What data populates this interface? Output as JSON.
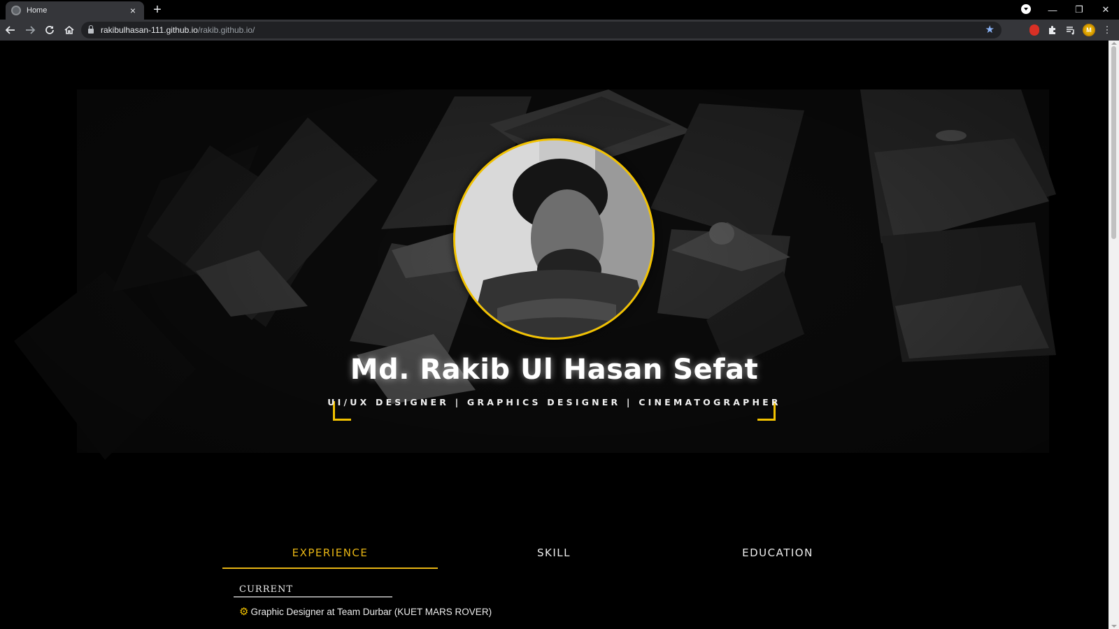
{
  "browser": {
    "tab_title": "Home",
    "tab_close": "×",
    "new_tab": "+",
    "url_host": "rakibulhasan-111.github.io",
    "url_path": "/rakib.github.io/"
  },
  "hero": {
    "name": "Md. Rakib Ul Hasan Sefat",
    "roles": "UI/UX DESIGNER | GRAPHICS DESIGNER | CINEMATOGRAPHER"
  },
  "tabs": [
    {
      "label": "EXPERIENCE",
      "active": true
    },
    {
      "label": "SKILL",
      "active": false
    },
    {
      "label": "EDUCATION",
      "active": false
    }
  ],
  "experience": {
    "section_heading": "CURRENT",
    "items": [
      "Graphic Designer at Team Durbar (KUET MARS ROVER)"
    ]
  },
  "colors": {
    "accent": "#f2c200",
    "background": "#000000",
    "chrome_toolbar": "#35363a"
  }
}
